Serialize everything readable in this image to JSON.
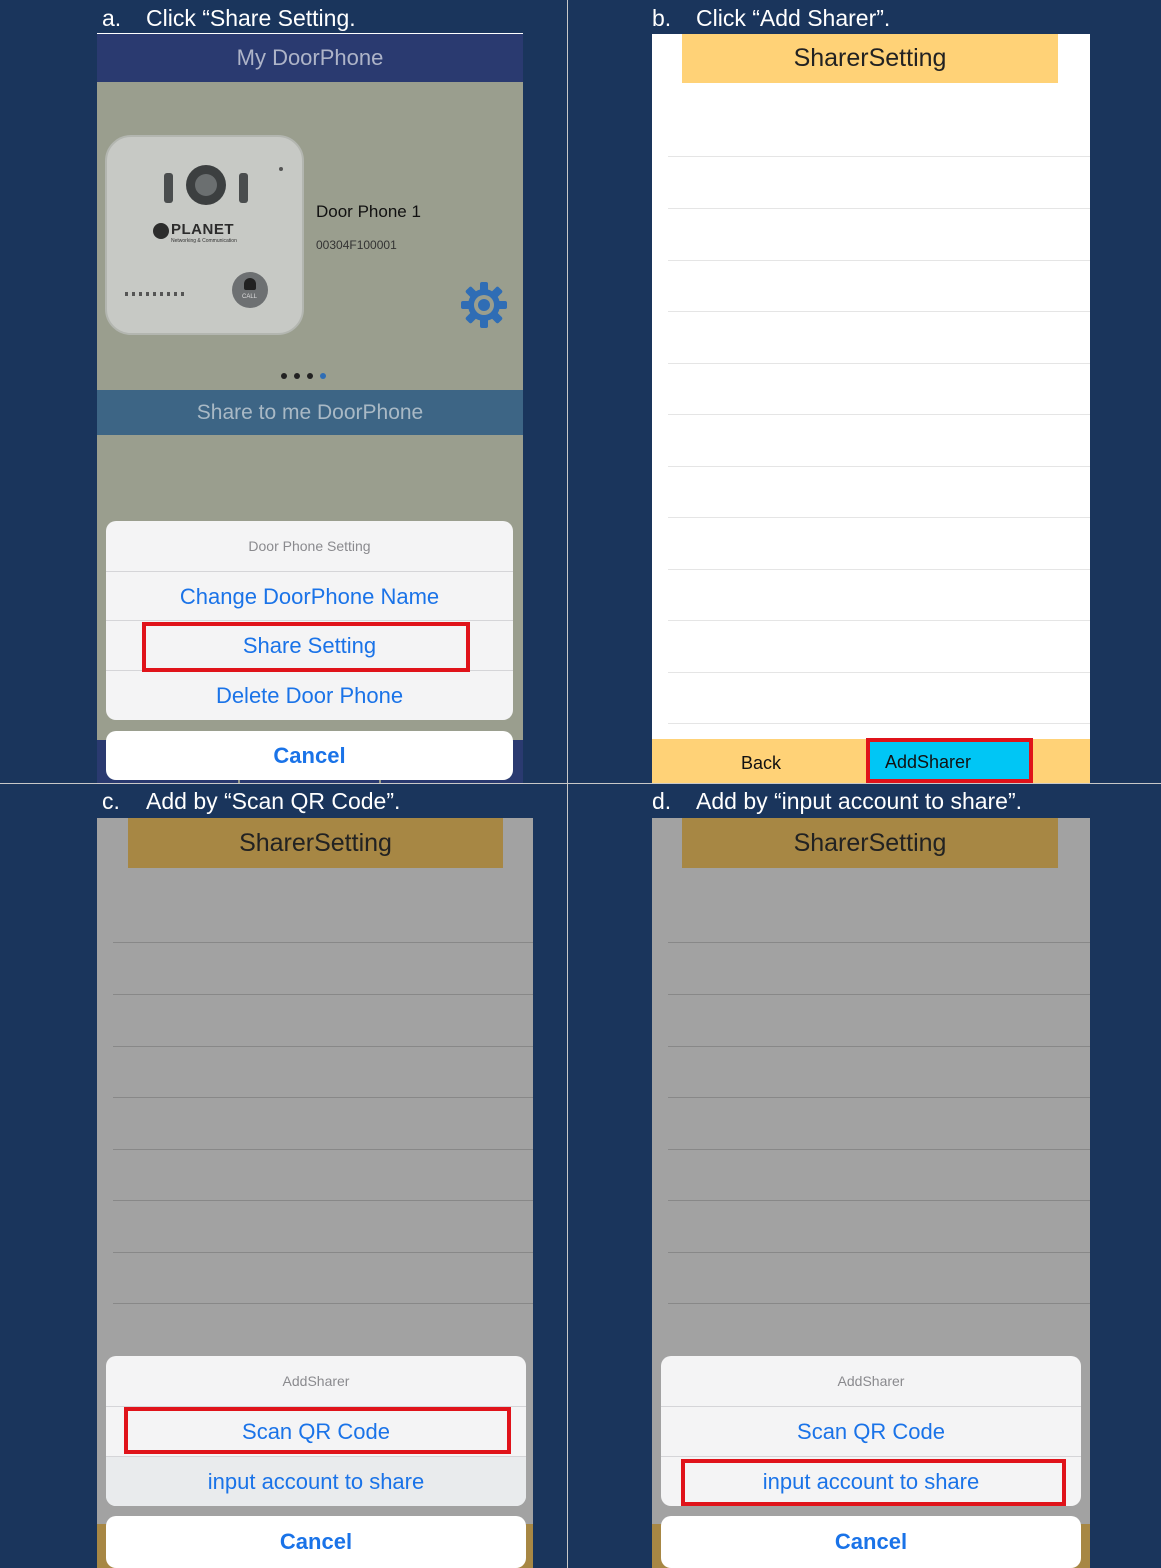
{
  "captions": {
    "a": {
      "letter": "a.",
      "text": "Click “Share Setting."
    },
    "b": {
      "letter": "b.",
      "text": "Click “Add Sharer”."
    },
    "c": {
      "letter": "c.",
      "text": "Add by “Scan QR Code”."
    },
    "d": {
      "letter": "d.",
      "text": "Add by “input account to share”."
    }
  },
  "screen_a": {
    "header_title": "My DoorPhone",
    "device_name": "Door Phone 1",
    "device_id": "00304F100001",
    "device_brand": "PLANET",
    "device_brand_sub": "Networking & Communication",
    "device_call_label": "CALL",
    "share_header": "Share to me DoorPhone",
    "sheet_title": "Door Phone Setting",
    "options": [
      "Change DoorPhone Name",
      "Share Setting",
      "Delete Door Phone"
    ],
    "cancel": "Cancel",
    "page_dots": 4,
    "active_dot": 4
  },
  "screen_b": {
    "title": "SharerSetting",
    "back": "Back",
    "add_sharer": "AddSharer"
  },
  "screen_c": {
    "title": "SharerSetting",
    "sheet_title": "AddSharer",
    "options": [
      "Scan QR Code",
      "input account to share"
    ],
    "cancel": "Cancel"
  },
  "screen_d": {
    "title": "SharerSetting",
    "sheet_title": "AddSharer",
    "options": [
      "Scan QR Code",
      "input account to share"
    ],
    "cancel": "Cancel"
  },
  "colors": {
    "panel_bg": "#1a355c",
    "highlight": "#e0131a",
    "ios_blue": "#1a73e8",
    "sharer_header": "#ffd277",
    "add_button": "#00c6f5"
  }
}
